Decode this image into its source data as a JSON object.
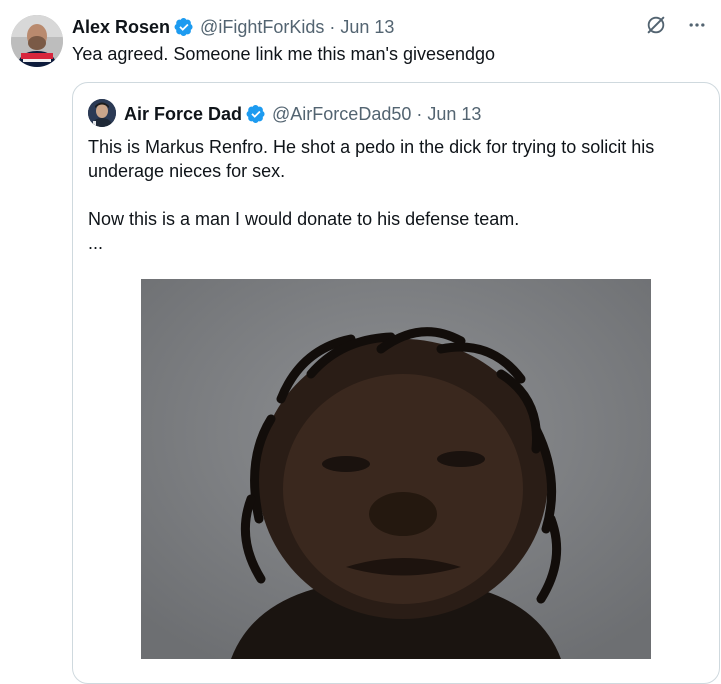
{
  "tweet": {
    "author_name": "Alex Rosen",
    "author_handle": "@iFightForKids",
    "date": "Jun 13",
    "text": "Yea agreed. Someone link me this man's givesendgo",
    "verified": true
  },
  "quoted_tweet": {
    "author_name": "Air Force Dad",
    "author_handle": "@AirForceDad50",
    "date": "Jun 13",
    "verified": true,
    "text_line1": "This is Markus Renfro. He shot a pedo in the dick for trying to solicit his",
    "text_line2": "underage nieces for sex.",
    "text_line3": "Now this is a man I would donate to his defense team.",
    "more": "..."
  },
  "icons": {
    "verified": "verified-badge-icon",
    "grok": "grok-icon",
    "more": "more-options-icon"
  },
  "colors": {
    "verified_blue": "#1d9bf0",
    "muted_text": "#536471",
    "border": "#cfd9de"
  }
}
